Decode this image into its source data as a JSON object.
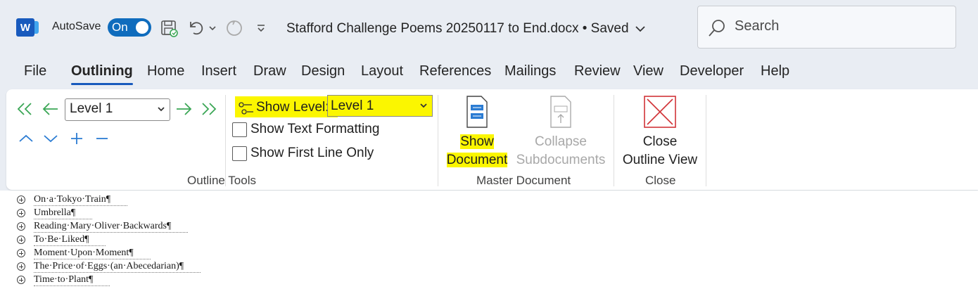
{
  "titlebar": {
    "app_logo": "W",
    "autosave_label": "AutoSave",
    "autosave_state": "On",
    "document_title": "Stafford Challenge Poems 20250117 to End.docx • Saved",
    "search_placeholder": "Search",
    "icons": [
      "word-logo",
      "save-icon",
      "undo-icon",
      "chevron-down-icon",
      "redo-icon",
      "customize-toolbar-icon",
      "search-icon"
    ]
  },
  "tabs": [
    {
      "label": "File"
    },
    {
      "label": "Outlining",
      "active": true
    },
    {
      "label": "Home"
    },
    {
      "label": "Insert"
    },
    {
      "label": "Draw"
    },
    {
      "label": "Design"
    },
    {
      "label": "Layout"
    },
    {
      "label": "References"
    },
    {
      "label": "Mailings"
    },
    {
      "label": "Review"
    },
    {
      "label": "View"
    },
    {
      "label": "Developer"
    },
    {
      "label": "Help"
    }
  ],
  "ribbon": {
    "outline_tools": {
      "group_label": "Outline Tools",
      "level_value": "Level 1",
      "show_level_label": "Show Level:",
      "show_level_value": "Level 1",
      "show_text_formatting": "Show Text Formatting",
      "show_first_line_only": "Show First Line Only",
      "show_text_formatting_checked": false,
      "show_first_line_only_checked": false
    },
    "master_document": {
      "group_label": "Master Document",
      "show_document_line1": "Show",
      "show_document_line2": "Document",
      "collapse_line1": "Collapse",
      "collapse_line2": "Subdocuments"
    },
    "close": {
      "group_label": "Close",
      "close_line1": "Close",
      "close_line2": "Outline View"
    },
    "highlight_color": "#fbf600",
    "accent_color": "#185abd",
    "arrow_color": "#3aa655",
    "move_color": "#2b7cd3",
    "close_color": "#d13438"
  },
  "document": {
    "items": [
      "On·a·Tokyo·Train¶",
      "Umbrella¶",
      "Reading·Mary·Oliver·Backwards¶",
      "To·Be·Liked¶",
      "Moment·Upon·Moment¶",
      "The·Price·of·Eggs·(an·Abecedarian)¶",
      "Time·to·Plant¶"
    ]
  }
}
